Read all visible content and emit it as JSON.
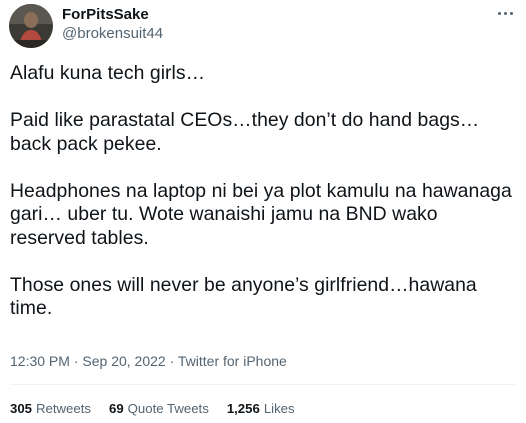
{
  "author": {
    "display_name": "ForPitsSake",
    "handle": "@brokensuit44",
    "avatar_icon": "profile-photo"
  },
  "tweet": {
    "paragraphs": [
      "Alafu kuna tech girls…",
      "Paid like parastatal CEOs…they don’t do hand bags… back pack pekee.",
      "Headphones na laptop ni bei ya plot kamulu na hawanaga gari… uber tu. Wote wanaishi jamu na BND wako reserved tables.",
      "Those ones will never be anyone’s girlfriend…hawana time."
    ]
  },
  "meta": {
    "time": "12:30 PM",
    "separator1": " · ",
    "date": "Sep 20, 2022",
    "separator2": " · ",
    "source": "Twitter for iPhone"
  },
  "stats": {
    "retweets_count": "305",
    "retweets_label": "Retweets",
    "quotes_count": "69",
    "quotes_label": "Quote Tweets",
    "likes_count": "1,256",
    "likes_label": "Likes"
  },
  "colors": {
    "text_primary": "#0f1419",
    "text_secondary": "#536471",
    "divider": "#eff3f4"
  }
}
